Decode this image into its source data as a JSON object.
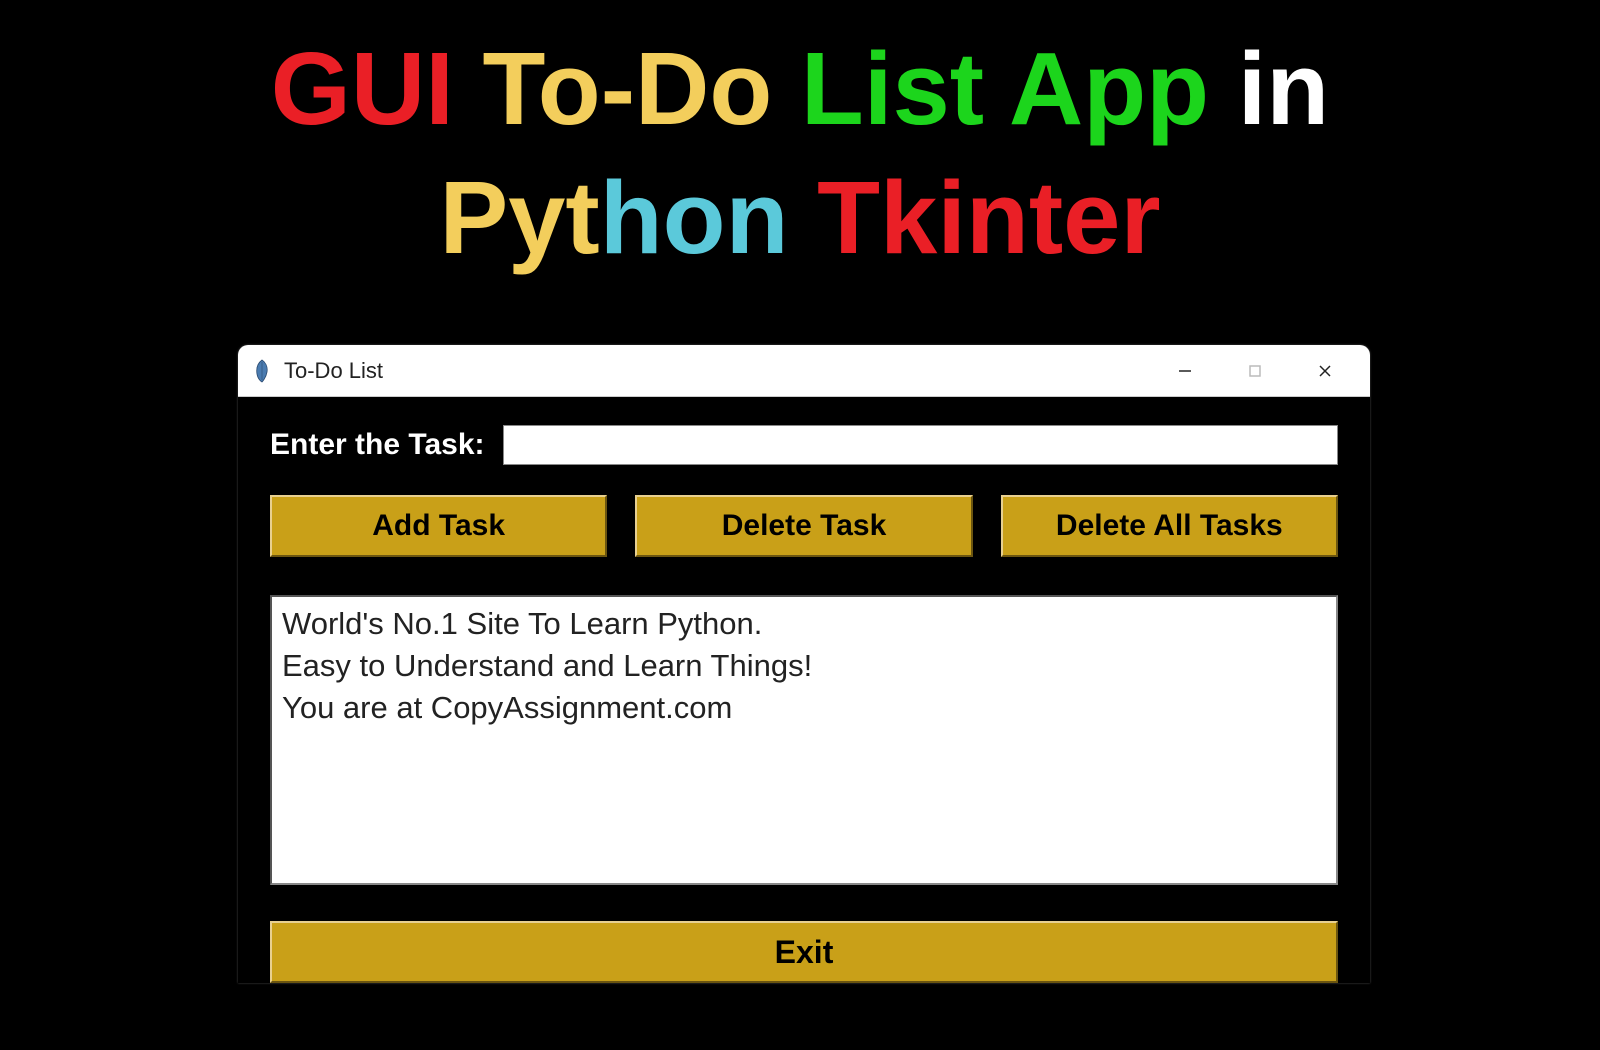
{
  "headline": {
    "part1": "GUI",
    "part2": "To-Do",
    "part3": "List App",
    "part4": "in",
    "part5": "Pyt",
    "part6": "hon",
    "part7": "Tkinter"
  },
  "window": {
    "title": "To-Do List"
  },
  "form": {
    "input_label": "Enter the Task:",
    "input_value": ""
  },
  "buttons": {
    "add": "Add Task",
    "delete": "Delete Task",
    "delete_all": "Delete All Tasks",
    "exit": "Exit"
  },
  "tasks": [
    "World's No.1 Site To Learn Python.",
    "Easy to Understand and Learn Things!",
    "You are at CopyAssignment.com"
  ],
  "colors": {
    "accent": "#c9a018",
    "bg": "#000000"
  }
}
